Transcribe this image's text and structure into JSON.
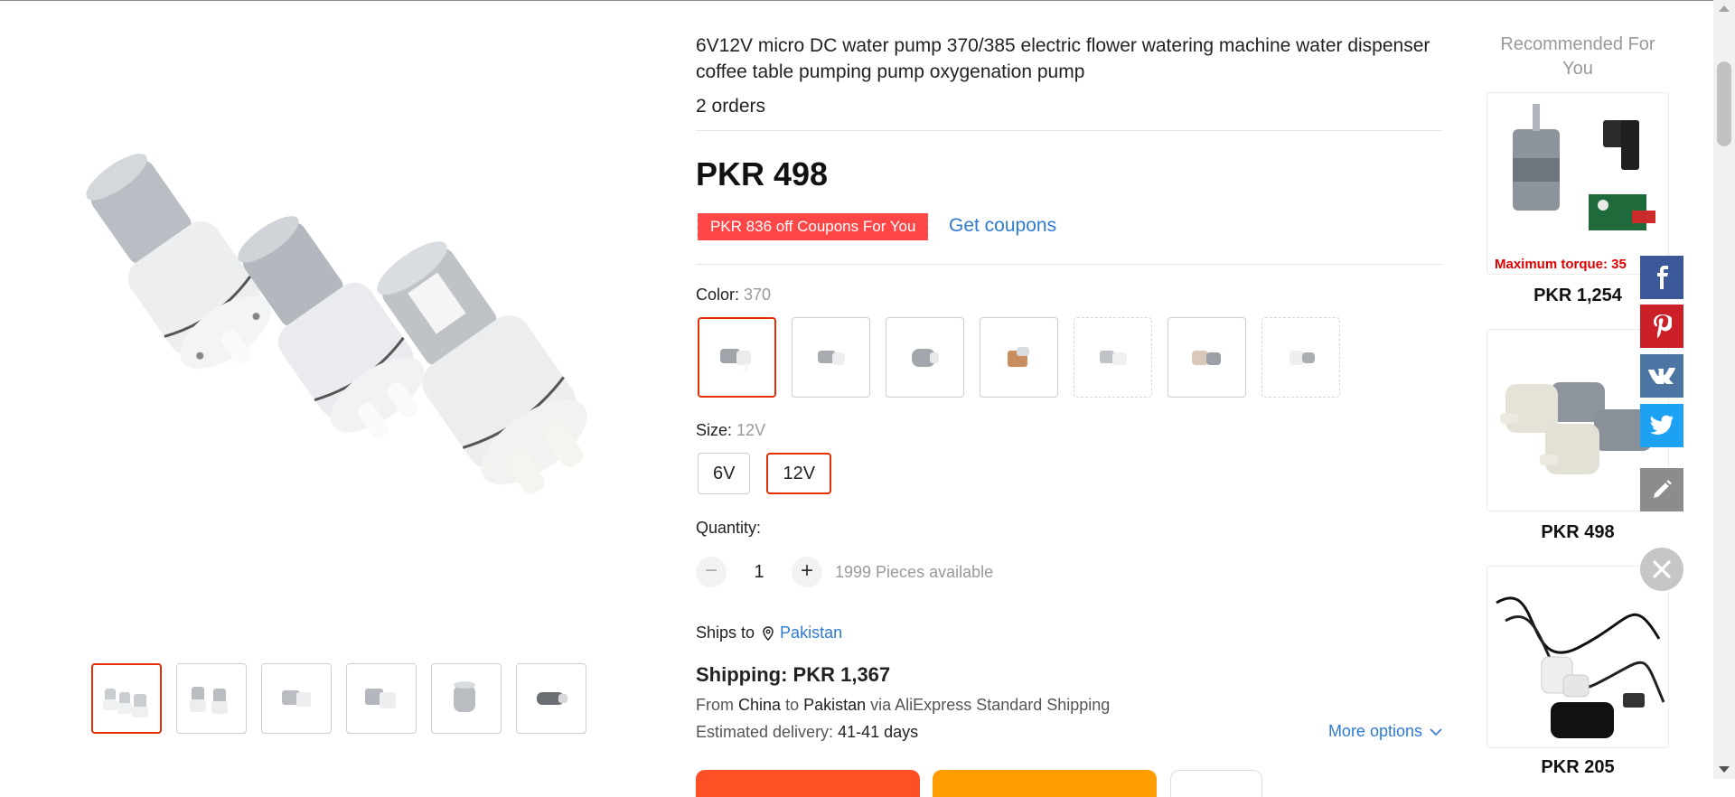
{
  "product": {
    "title": "6V12V micro DC water pump 370/385 electric flower watering machine water dispenser coffee table pumping pump oxygenation pump",
    "orders": "2 orders",
    "price": "PKR 498",
    "coupon_tag": "PKR 836 off Coupons For You",
    "get_coupons": "Get coupons",
    "color_label": "Color:",
    "color_value": "370",
    "size_label": "Size:",
    "size_value": "12V",
    "sizes": [
      "6V",
      "12V"
    ],
    "quantity_label": "Quantity:",
    "quantity_value": "1",
    "available": "1999 Pieces available",
    "ships_to_label": "Ships to",
    "ships_to_country": "Pakistan",
    "shipping": "Shipping: PKR 1,367",
    "from_text": "From",
    "from_country": "China",
    "to_text": "to",
    "to_country": "Pakistan",
    "via_text": "via AliExpress Standard Shipping",
    "est_label": "Estimated delivery:",
    "est_days": "41-41 days",
    "more_options": "More options"
  },
  "recommended": {
    "title": "Recommended For You",
    "items": [
      {
        "price": "PKR 1,254",
        "caption": "Maximum torque: 35"
      },
      {
        "price": "PKR 498"
      },
      {
        "price": "PKR 205"
      }
    ]
  },
  "share": {
    "facebook": {
      "color": "#3b5998",
      "icon": "facebook-icon"
    },
    "pinterest": {
      "color": "#cb2027",
      "icon": "pinterest-icon"
    },
    "vk": {
      "color": "#4c75a3",
      "icon": "vk-icon"
    },
    "twitter": {
      "color": "#1da1f2",
      "icon": "twitter-icon"
    },
    "edit": {
      "color": "#8c8c8c",
      "icon": "pencil-icon"
    }
  },
  "colors": {
    "accent": "#e62e04",
    "coupon": "#ff4747",
    "link": "#2e7bd1"
  }
}
